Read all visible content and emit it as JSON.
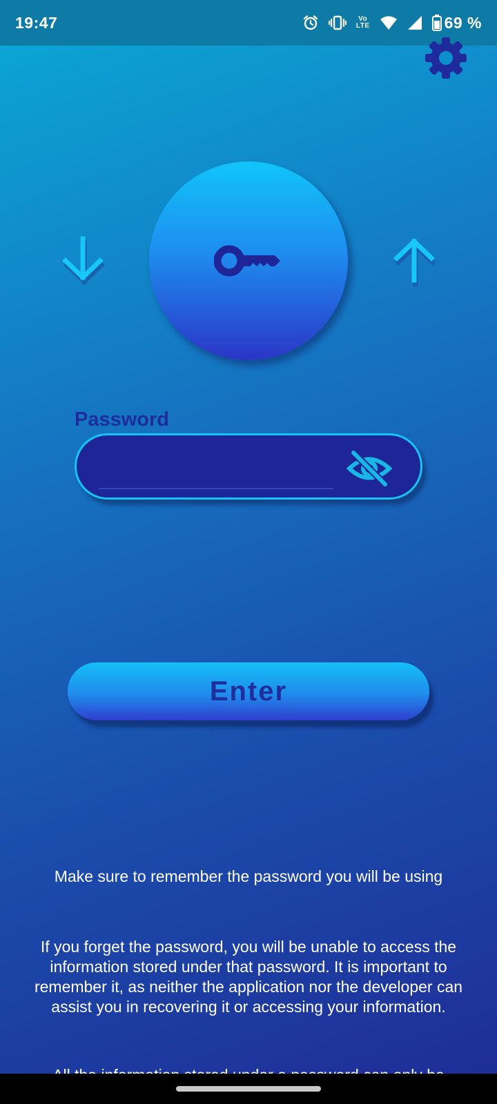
{
  "status_bar": {
    "time": "19:47",
    "network_label_top": "Vo",
    "network_label_bottom": "LTE",
    "battery": "69 %",
    "icons": [
      "alarm-icon",
      "vibrate-icon",
      "volte-icon",
      "wifi-icon",
      "signal-icon",
      "battery-icon"
    ]
  },
  "header": {
    "settings_icon": "gear-icon"
  },
  "hero": {
    "left_icon": "arrow-down-icon",
    "center_icon": "key-icon",
    "right_icon": "arrow-up-icon"
  },
  "form": {
    "password_label": "Password",
    "password_value": "",
    "password_placeholder": "",
    "visibility_icon": "eye-off-icon",
    "enter_label": "Enter"
  },
  "info": {
    "remember": "Make sure to remember the password you will be using",
    "warning": "If you forget the password, you will be unable to access the information stored under that password. It is important to remember it, as neither the application nor the developer can assist you in recovering it or accessing your information.",
    "storage": "All the information stored under a password can only be"
  },
  "colors": {
    "background_top": "#0aa9d6",
    "background_bottom": "#1f2b96",
    "accent_cyan": "#17c4f6",
    "dark_blue": "#1e2596",
    "label_blue": "#1e2d9e"
  }
}
